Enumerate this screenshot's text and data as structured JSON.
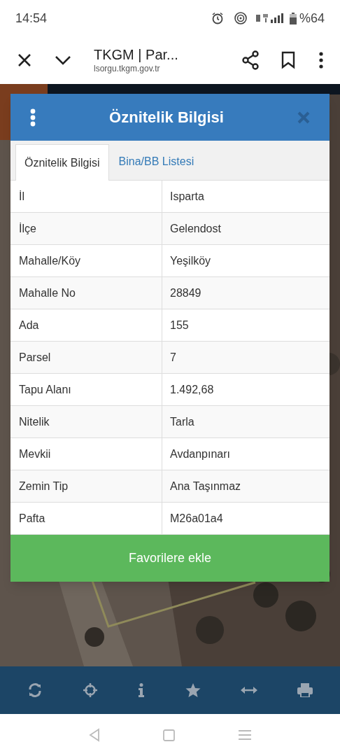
{
  "status_bar": {
    "time": "14:54",
    "battery": "%64"
  },
  "browser": {
    "title": "TKGM | Par...",
    "url": "lsorgu.tkgm.gov.tr"
  },
  "dialog": {
    "title": "Öznitelik Bilgisi",
    "tabs": [
      {
        "label": "Öznitelik Bilgisi",
        "selected": true
      },
      {
        "label": "Bina/BB Listesi",
        "selected": false
      }
    ],
    "rows": [
      {
        "label": "İl",
        "value": "Isparta"
      },
      {
        "label": "İlçe",
        "value": "Gelendost"
      },
      {
        "label": "Mahalle/Köy",
        "value": "Yeşilköy"
      },
      {
        "label": "Mahalle No",
        "value": "28849"
      },
      {
        "label": "Ada",
        "value": "155"
      },
      {
        "label": "Parsel",
        "value": "7"
      },
      {
        "label": "Tapu Alanı",
        "value": "1.492,68"
      },
      {
        "label": "Nitelik",
        "value": "Tarla"
      },
      {
        "label": "Mevkii",
        "value": "Avdanpınarı"
      },
      {
        "label": "Zemin Tip",
        "value": "Ana Taşınmaz"
      },
      {
        "label": "Pafta",
        "value": "M26a01a4"
      }
    ],
    "button": "Favorilere ekle"
  }
}
